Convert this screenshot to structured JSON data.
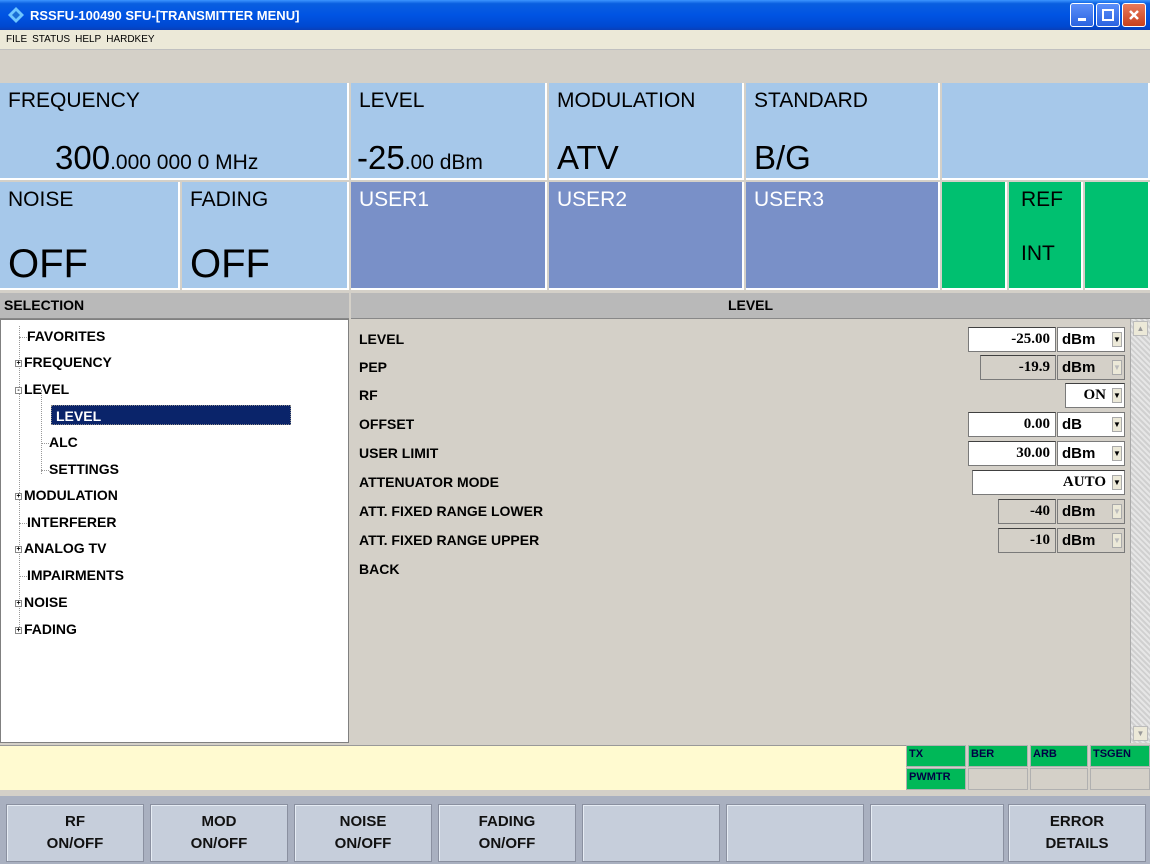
{
  "window": {
    "title": "RSSFU-100490  SFU-[TRANSMITTER MENU]"
  },
  "menu": [
    "FILE",
    "STATUS",
    "HELP",
    "HARDKEY"
  ],
  "header": {
    "frequency": {
      "label": "FREQUENCY",
      "value_main": "300",
      "value_fraction": ".000 000 0",
      "unit": "MHz"
    },
    "level": {
      "label": "LEVEL",
      "value_main": "-25",
      "value_fraction": ".00",
      "unit": "dBm"
    },
    "modulation": {
      "label": "MODULATION",
      "value": "ATV"
    },
    "standard": {
      "label": "STANDARD",
      "value": "B/G"
    },
    "noise": {
      "label": "NOISE",
      "value": "OFF"
    },
    "fading": {
      "label": "FADING",
      "value": "OFF"
    },
    "user1": "USER1",
    "user2": "USER2",
    "user3": "USER3",
    "ref": {
      "label": "REF",
      "value": "INT"
    }
  },
  "selection": {
    "title": "SELECTION",
    "items": [
      "FAVORITES",
      "FREQUENCY",
      "LEVEL",
      "LEVEL",
      "ALC",
      "SETTINGS",
      "MODULATION",
      "INTERFERER",
      "ANALOG TV",
      "IMPAIRMENTS",
      "NOISE",
      "FADING"
    ]
  },
  "level_panel": {
    "title": "LEVEL",
    "params": {
      "level": {
        "label": "LEVEL",
        "value": "-25.00",
        "unit": "dBm"
      },
      "pep": {
        "label": "PEP",
        "value": "-19.9",
        "unit": "dBm"
      },
      "rf": {
        "label": "RF",
        "value": "ON"
      },
      "offset": {
        "label": "OFFSET",
        "value": "0.00",
        "unit": "dB"
      },
      "user_limit": {
        "label": "USER LIMIT",
        "value": "30.00",
        "unit": "dBm"
      },
      "att_mode": {
        "label": "ATTENUATOR MODE",
        "value": "AUTO"
      },
      "att_lower": {
        "label": "ATT. FIXED RANGE LOWER",
        "value": "-40",
        "unit": "dBm"
      },
      "att_upper": {
        "label": "ATT. FIXED RANGE UPPER",
        "value": "-10",
        "unit": "dBm"
      },
      "back": {
        "label": "BACK"
      }
    }
  },
  "indicators": {
    "tx": "TX",
    "ber": "BER",
    "arb": "ARB",
    "tsgen": "TSGEN",
    "pwmtr": "PWMTR"
  },
  "softkeys": {
    "rf": [
      "RF",
      "ON/OFF"
    ],
    "mod": [
      "MOD",
      "ON/OFF"
    ],
    "noise": [
      "NOISE",
      "ON/OFF"
    ],
    "fading": [
      "FADING",
      "ON/OFF"
    ],
    "error": [
      "ERROR",
      "DETAILS"
    ]
  },
  "colors": {
    "title_bar": "#0054e3",
    "header_light": "#a6c8ea",
    "header_dark": "#7990c8",
    "ref_green": "#00c070",
    "info_yellow": "#fffad0"
  }
}
